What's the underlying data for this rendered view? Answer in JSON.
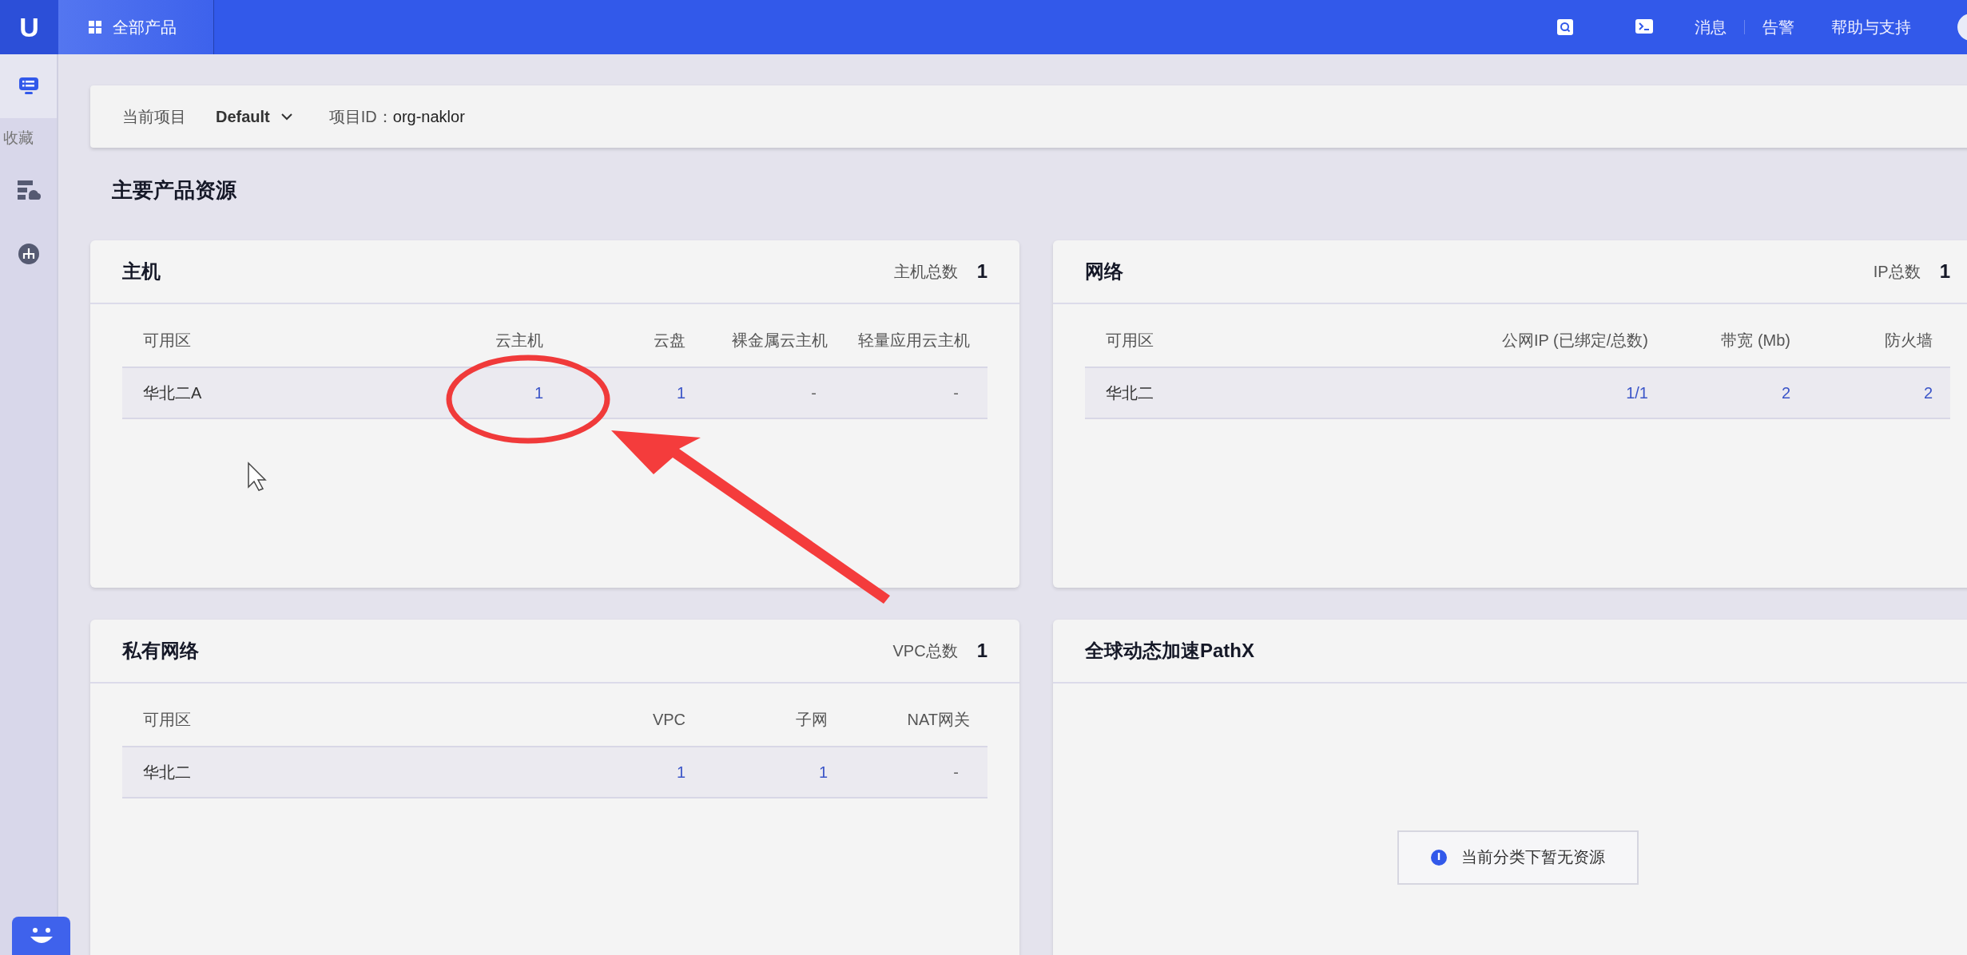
{
  "top_bar": {
    "logo": "U",
    "all_products": "全部产品",
    "links": [
      "消息",
      "告警",
      "帮助与支持"
    ]
  },
  "sidebar": {
    "items": [
      {
        "kind": "icon",
        "selected": true
      },
      {
        "kind": "text",
        "label": "收藏",
        "selected": false
      },
      {
        "kind": "icon",
        "selected": false
      },
      {
        "kind": "icon",
        "selected": false
      }
    ]
  },
  "project_bar": {
    "label": "当前项目",
    "project": "Default",
    "id_label": "项目ID：",
    "id": "org-naklor"
  },
  "section_title": "主要产品资源",
  "cards": [
    {
      "title": "主机",
      "total_label": "主机总数",
      "total": "1",
      "columns": [
        "可用区",
        "云主机",
        "云盘",
        "裸金属云主机",
        "轻量应用云主机"
      ],
      "rows": [
        [
          {
            "text": "华北二A",
            "link": false
          },
          {
            "text": "1",
            "link": true
          },
          {
            "text": "1",
            "link": true
          },
          {
            "text": "-",
            "link": false
          },
          {
            "text": "-",
            "link": false
          }
        ]
      ]
    },
    {
      "title": "网络",
      "total_label": "IP总数",
      "total": "1",
      "columns": [
        "可用区",
        "公网IP (已绑定/总数)",
        "带宽 (Mb)",
        "防火墙"
      ],
      "rows": [
        [
          {
            "text": "华北二",
            "link": false
          },
          {
            "text": "1/1",
            "link": true
          },
          {
            "text": "2",
            "link": true
          },
          {
            "text": "2",
            "link": true
          }
        ]
      ]
    },
    {
      "title": "私有网络",
      "total_label": "VPC总数",
      "total": "1",
      "columns": [
        "可用区",
        "VPC",
        "子网",
        "NAT网关"
      ],
      "rows": [
        [
          {
            "text": "华北二",
            "link": false
          },
          {
            "text": "1",
            "link": true
          },
          {
            "text": "1",
            "link": true
          },
          {
            "text": "-",
            "link": false
          }
        ]
      ]
    },
    {
      "title": "全球动态加速PathX",
      "empty": "当前分类下暂无资源"
    }
  ]
}
